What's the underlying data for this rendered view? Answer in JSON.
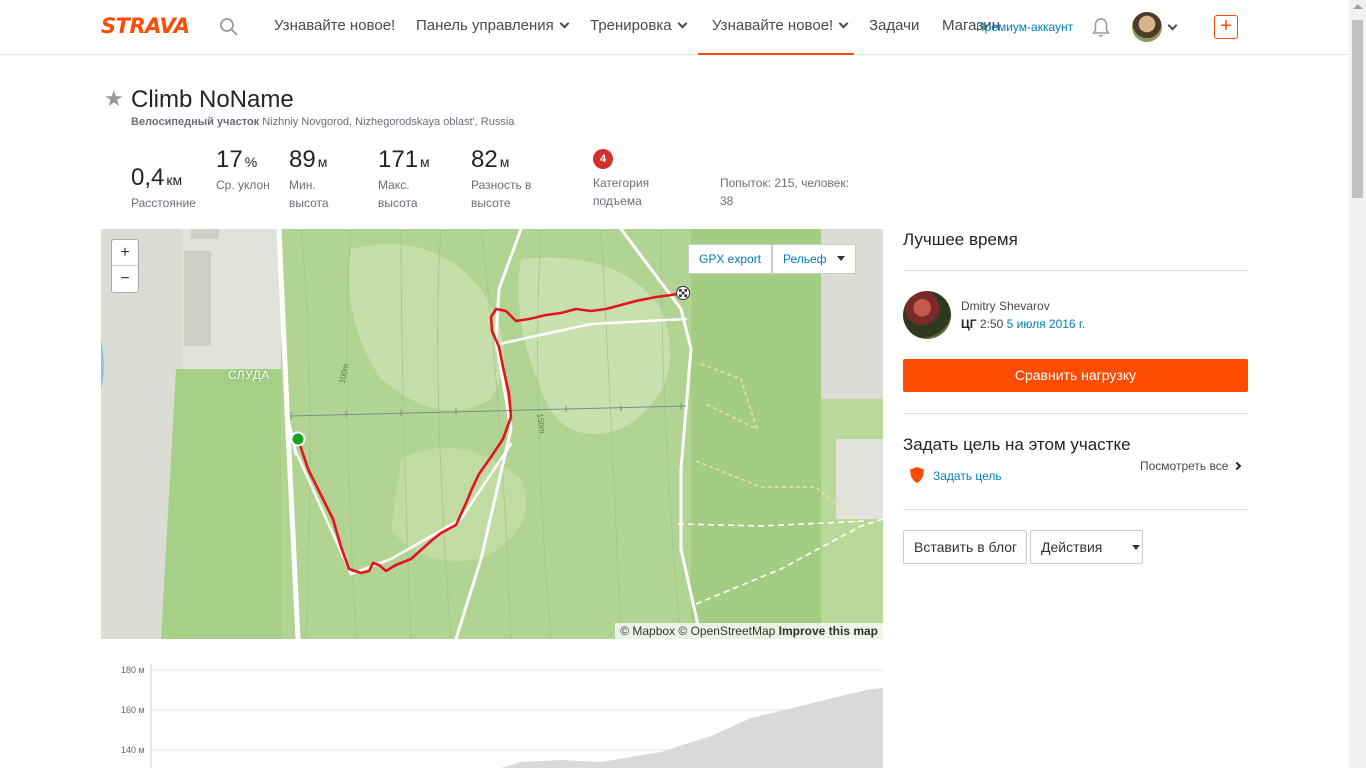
{
  "nav": {
    "logo": "STRAVA",
    "items": [
      {
        "label": "Узнавайте новое!",
        "dropdown": false
      },
      {
        "label": "Панель управления",
        "dropdown": true
      },
      {
        "label": "Тренировка",
        "dropdown": true
      },
      {
        "label": "Узнавайте новое!",
        "dropdown": true,
        "active": true
      },
      {
        "label": "Задачи",
        "dropdown": false
      },
      {
        "label": "Магазин",
        "dropdown": false
      }
    ],
    "premium": "Премиум-аккаунт",
    "plus": "+"
  },
  "segment": {
    "title": "Climb NoName",
    "type": "Велосипедный участок",
    "location": "Nizhniy Novgorod, Nizhegorodskaya oblast', Russia",
    "stats": [
      {
        "value": "0,4",
        "unit": "км",
        "label": "Расстояние"
      },
      {
        "value": "17",
        "unit": "%",
        "label": "Ср. уклон"
      },
      {
        "value": "89",
        "unit": "м",
        "label": "Мин. высота"
      },
      {
        "value": "171",
        "unit": "м",
        "label": "Макс. высота"
      },
      {
        "value": "82",
        "unit": "м",
        "label": "Разность в высоте"
      }
    ],
    "category": {
      "badge": "4",
      "label": "Категория подъема"
    },
    "attempts": "Попыток: 215, человек: 38"
  },
  "map": {
    "zoom_in": "+",
    "zoom_out": "−",
    "gpx_export": "GPX export",
    "terrain": "Рельеф",
    "place_label": "СЛУДА",
    "contour_labels": [
      "100m",
      "150m"
    ],
    "attribution_mapbox": "© Mapbox © OpenStreetMap",
    "attribution_improve": "Improve this map",
    "colors": {
      "route": "#e3141f",
      "start": "#19a01f",
      "land": "#b9d99a",
      "road": "#ffffff"
    }
  },
  "elevation": {
    "y_labels": [
      "180 м",
      "160 м",
      "140 м"
    ]
  },
  "sidebar": {
    "best_title": "Лучшее время",
    "leader_name": "Dmitry Shevarov",
    "leader_label": "ЦГ",
    "leader_time": "2:50",
    "leader_date": "5 июля 2016 г.",
    "compare_button": "Сравнить нагрузку",
    "goal_title": "Задать цель на этом участке",
    "goal_link": "Задать цель",
    "see_all": "Посмотреть все",
    "embed_button": "Вставить в блог",
    "actions_button": "Действия"
  }
}
